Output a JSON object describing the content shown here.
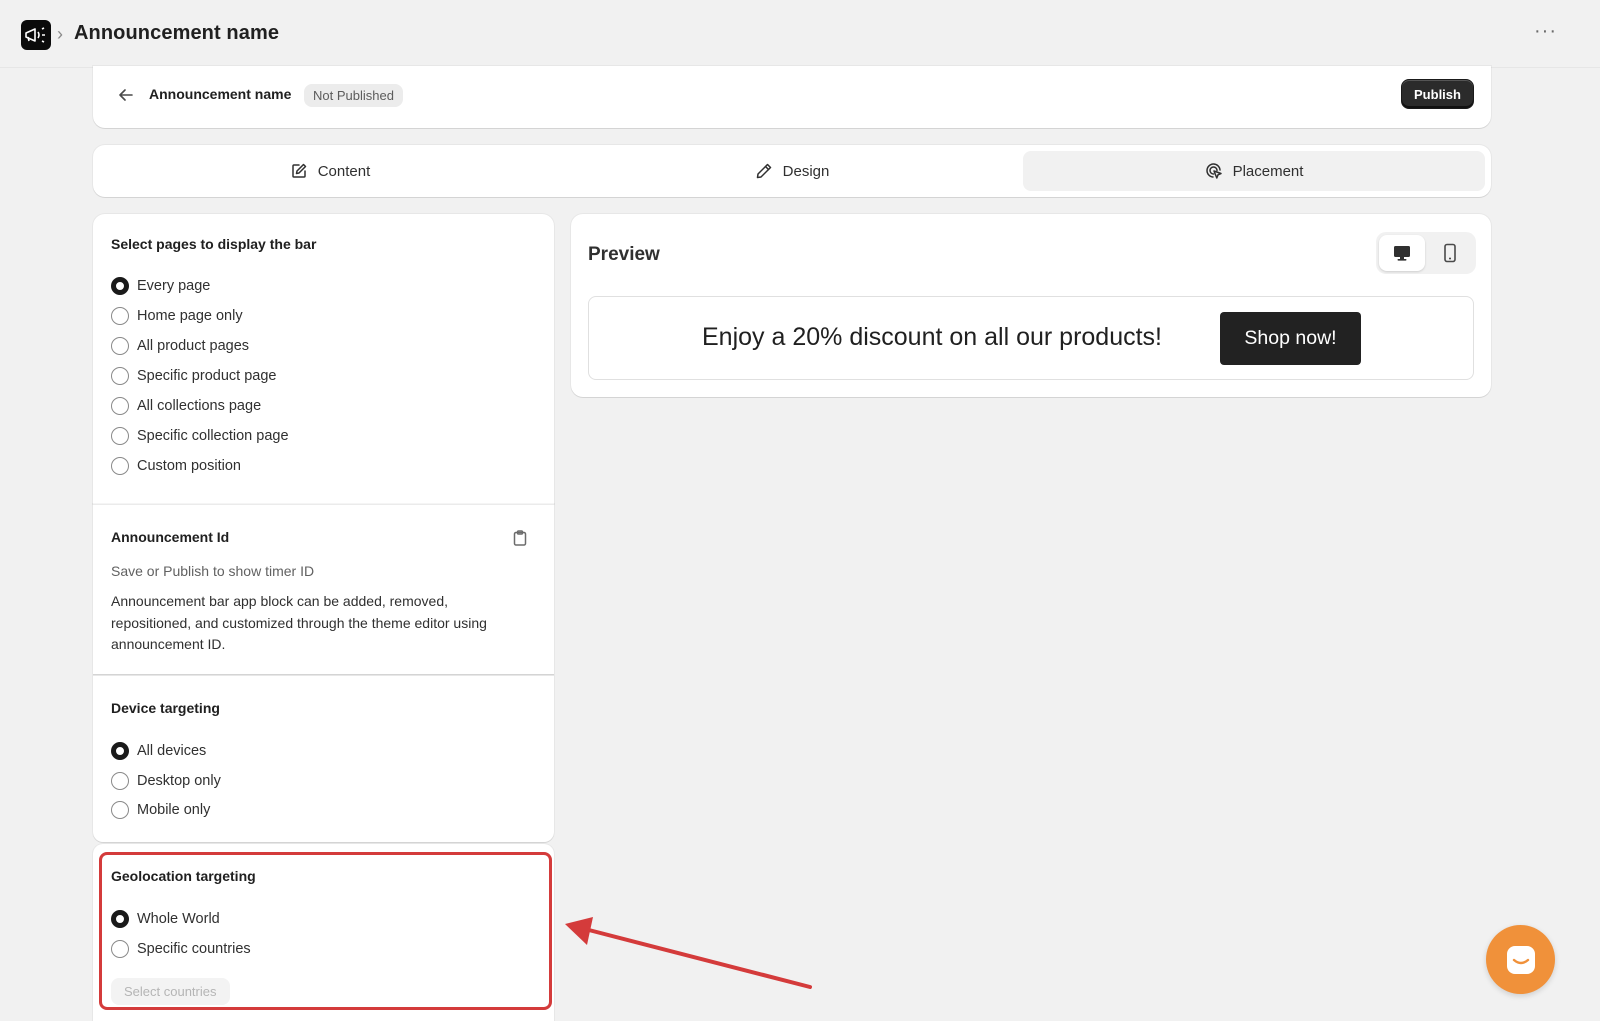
{
  "app": {
    "title": "Announcement name",
    "logo_icon": "megaphone-icon",
    "more_label": "···"
  },
  "header": {
    "name": "Announcement name",
    "status": "Not Published",
    "publish_label": "Publish"
  },
  "tabs": [
    {
      "label": "Content",
      "icon": "edit-icon"
    },
    {
      "label": "Design",
      "icon": "pencil-icon"
    },
    {
      "label": "Placement",
      "icon": "cursor-click-icon",
      "active": true
    }
  ],
  "pages_section": {
    "title": "Select pages to display the bar",
    "options": [
      {
        "label": "Every page",
        "checked": true
      },
      {
        "label": "Home page only",
        "checked": false
      },
      {
        "label": "All product pages",
        "checked": false
      },
      {
        "label": "Specific product page",
        "checked": false
      },
      {
        "label": "All collections page",
        "checked": false
      },
      {
        "label": "Specific collection page",
        "checked": false
      },
      {
        "label": "Custom position",
        "checked": false
      }
    ]
  },
  "id_section": {
    "title": "Announcement Id",
    "hint": "Save or Publish to show timer ID",
    "description": "Announcement bar app block can be added, removed, repositioned, and customized through the theme editor using announcement ID."
  },
  "device_section": {
    "title": "Device targeting",
    "options": [
      {
        "label": "All devices",
        "checked": true
      },
      {
        "label": "Desktop only",
        "checked": false
      },
      {
        "label": "Mobile only",
        "checked": false
      }
    ]
  },
  "geo_section": {
    "title": "Geolocation targeting",
    "options": [
      {
        "label": "Whole World",
        "checked": true
      },
      {
        "label": "Specific countries",
        "checked": false
      }
    ],
    "select_label": "Select countries"
  },
  "preview": {
    "title": "Preview",
    "bar_text": "Enjoy a 20% discount on all our products!",
    "button_label": "Shop now!"
  },
  "colors": {
    "highlight": "#d43b3b",
    "chat": "#f0913a"
  }
}
